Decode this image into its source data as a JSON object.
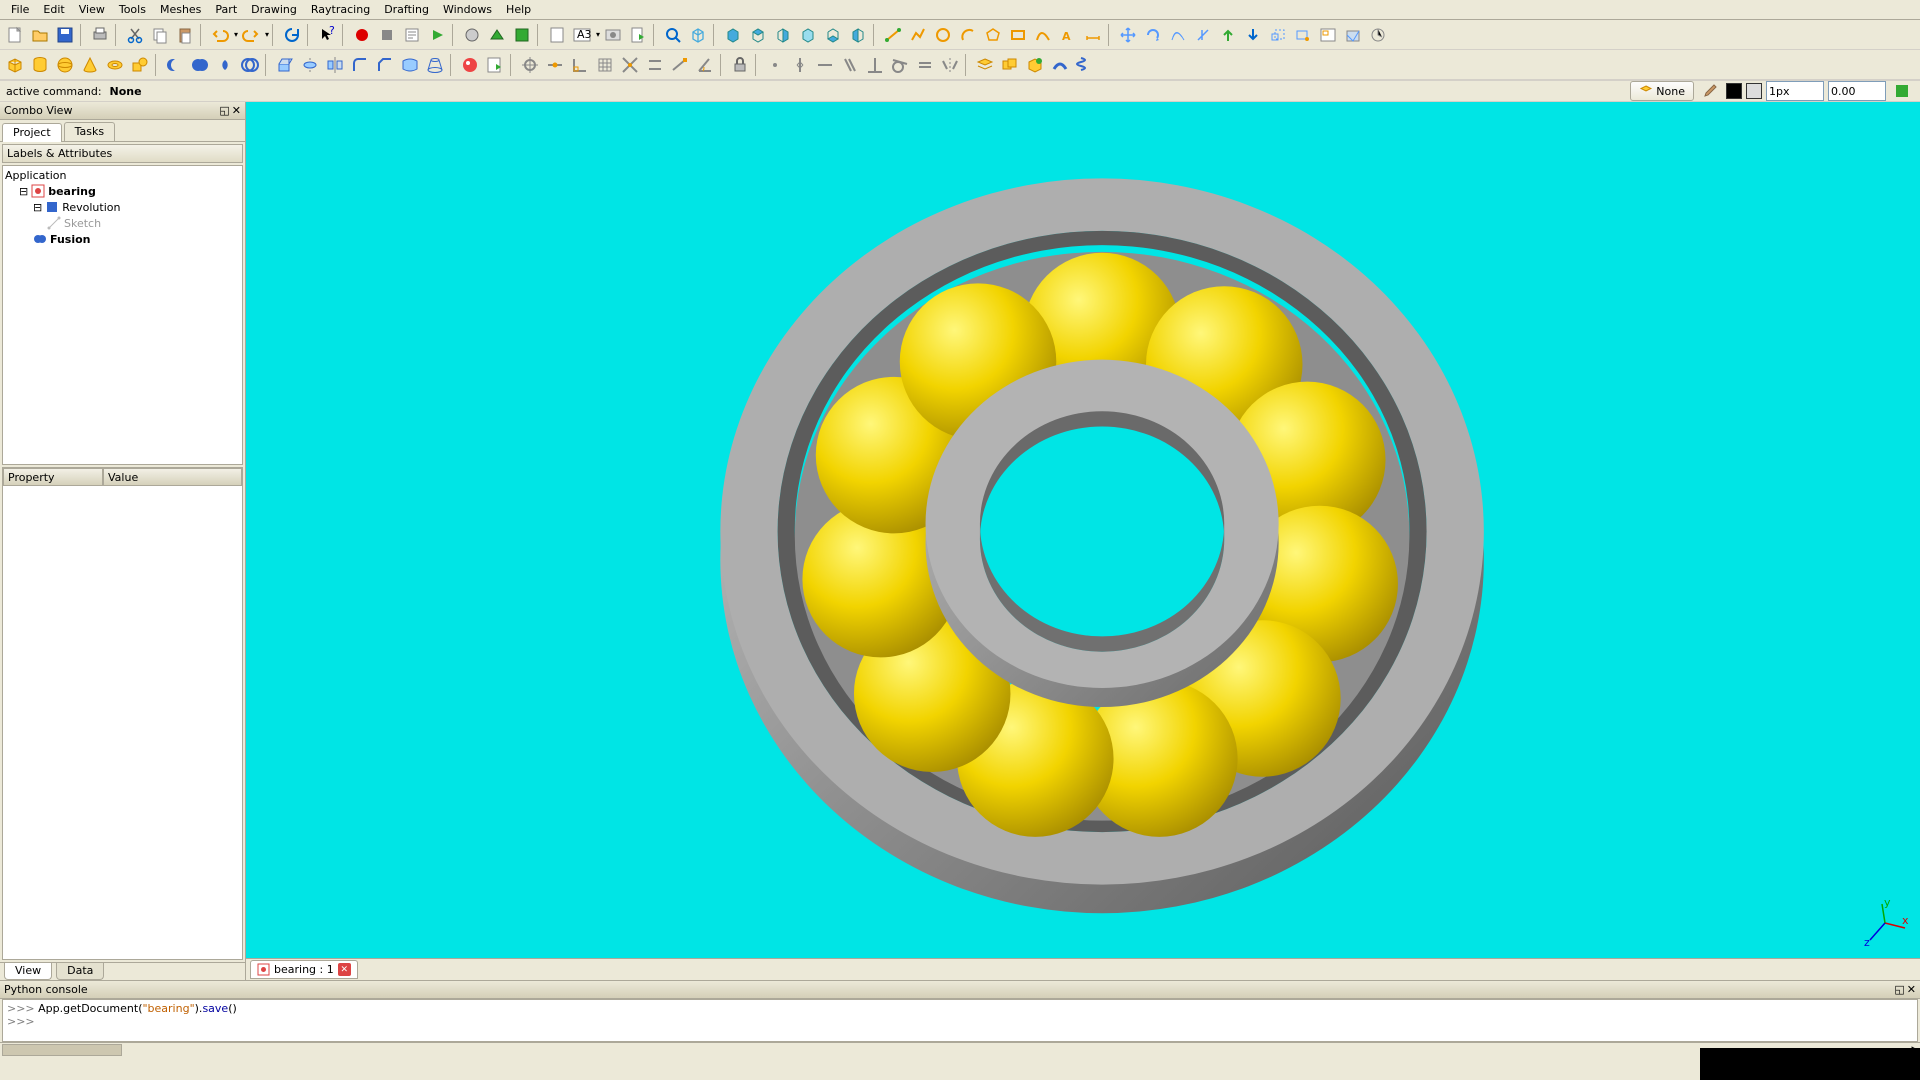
{
  "menu": {
    "items": [
      "File",
      "Edit",
      "View",
      "Tools",
      "Meshes",
      "Part",
      "Drawing",
      "Raytracing",
      "Drafting",
      "Windows",
      "Help"
    ]
  },
  "status": {
    "label": "active command:",
    "value": "None"
  },
  "combo": {
    "title": "Combo View",
    "tabs": {
      "project": "Project",
      "tasks": "Tasks"
    },
    "labels_header": "Labels & Attributes",
    "tree": {
      "root": "Application",
      "doc": "bearing",
      "items": [
        "Revolution",
        "Sketch",
        "Fusion"
      ]
    },
    "prop": {
      "col1": "Property",
      "col2": "Value"
    },
    "bottom_tabs": {
      "view": "View",
      "data": "Data"
    }
  },
  "doc_tab": {
    "label": "bearing : 1"
  },
  "py": {
    "title": "Python console",
    "prompt": ">>> ",
    "line1_parts": [
      "App.getDocument(",
      "\"bearing\"",
      ").",
      "save",
      "()"
    ]
  },
  "right_bar": {
    "none": "None",
    "px": "1px",
    "val": "0.00"
  }
}
